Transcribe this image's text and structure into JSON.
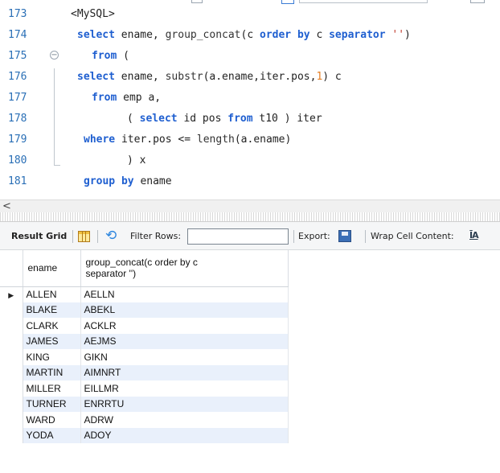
{
  "editor": {
    "lines": [
      {
        "num": "173",
        "tokens": [
          {
            "t": "<MySQL>",
            "c": "plain"
          }
        ],
        "indent": 14
      },
      {
        "num": "174",
        "tokens": [
          {
            "t": "select",
            "c": "kw"
          },
          {
            "t": " ename, ",
            "c": "plain"
          },
          {
            "t": "group_concat",
            "c": "fn"
          },
          {
            "t": "(c ",
            "c": "plain"
          },
          {
            "t": "order by",
            "c": "kw"
          },
          {
            "t": " c ",
            "c": "plain"
          },
          {
            "t": "separator",
            "c": "kw"
          },
          {
            "t": " ",
            "c": "plain"
          },
          {
            "t": "''",
            "c": "str"
          },
          {
            "t": ")",
            "c": "plain"
          }
        ],
        "indent": 22
      },
      {
        "num": "175",
        "tokens": [
          {
            "t": "from",
            "c": "kw"
          },
          {
            "t": " (",
            "c": "plain"
          }
        ],
        "indent": 40,
        "fold": "-"
      },
      {
        "num": "176",
        "tokens": [
          {
            "t": "select",
            "c": "kw"
          },
          {
            "t": " ename, ",
            "c": "plain"
          },
          {
            "t": "substr",
            "c": "fn"
          },
          {
            "t": "(a.ename,iter.pos,",
            "c": "plain"
          },
          {
            "t": "1",
            "c": "num"
          },
          {
            "t": ") c",
            "c": "plain"
          }
        ],
        "indent": 22
      },
      {
        "num": "177",
        "tokens": [
          {
            "t": "from",
            "c": "kw"
          },
          {
            "t": " emp a,",
            "c": "plain"
          }
        ],
        "indent": 40
      },
      {
        "num": "178",
        "tokens": [
          {
            "t": "( ",
            "c": "plain"
          },
          {
            "t": "select",
            "c": "kw"
          },
          {
            "t": " id pos ",
            "c": "plain"
          },
          {
            "t": "from",
            "c": "kw"
          },
          {
            "t": " t10 ) iter",
            "c": "plain"
          }
        ],
        "indent": 84
      },
      {
        "num": "179",
        "tokens": [
          {
            "t": "where",
            "c": "kw"
          },
          {
            "t": " iter.pos <= ",
            "c": "plain"
          },
          {
            "t": "length",
            "c": "fn"
          },
          {
            "t": "(a.ename)",
            "c": "plain"
          }
        ],
        "indent": 30
      },
      {
        "num": "180",
        "tokens": [
          {
            "t": ") x",
            "c": "plain"
          }
        ],
        "indent": 84
      },
      {
        "num": "181",
        "tokens": [
          {
            "t": "group by",
            "c": "kw"
          },
          {
            "t": " ename",
            "c": "plain"
          }
        ],
        "indent": 30
      }
    ]
  },
  "scroll_arrow": "<",
  "toolbar": {
    "result_grid_label": "Result Grid",
    "filter_label": "Filter Rows:",
    "filter_value": "",
    "export_label": "Export:",
    "wrap_label": "Wrap Cell Content:",
    "wrap_icon_text": "ĪA"
  },
  "grid": {
    "columns": [
      "ename",
      "group_concat(c order by c separator '')"
    ],
    "column2_display": "group_concat(c order by c\nseparator '')",
    "rows": [
      [
        "ALLEN",
        "AELLN"
      ],
      [
        "BLAKE",
        "ABEKL"
      ],
      [
        "CLARK",
        "ACKLR"
      ],
      [
        "JAMES",
        "AEJMS"
      ],
      [
        "KING",
        "GIKN"
      ],
      [
        "MARTIN",
        "AIMNRT"
      ],
      [
        "MILLER",
        "EILLMR"
      ],
      [
        "TURNER",
        "ENRRTU"
      ],
      [
        "WARD",
        "ADRW"
      ],
      [
        "YODA",
        "ADOY"
      ]
    ]
  },
  "colors": {
    "keyword": "#1f5fd0",
    "line_number": "#2a6fb6",
    "string": "#c0392b",
    "number": "#e67e22",
    "alt_row": "#e9f0fb"
  }
}
